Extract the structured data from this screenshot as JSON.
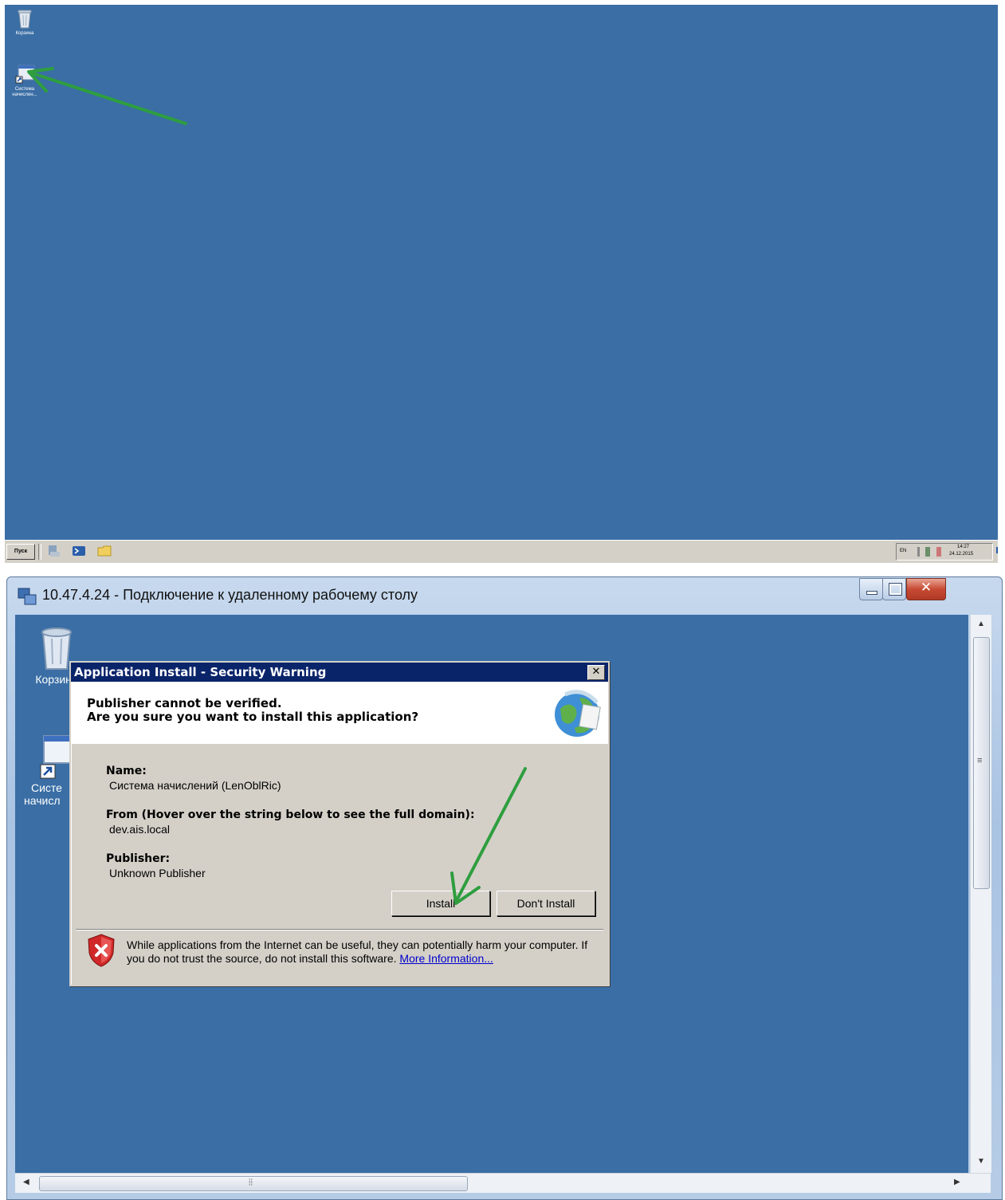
{
  "top_screen": {
    "desktop_icons": [
      {
        "name": "recycle-bin",
        "label": "Корзина"
      },
      {
        "name": "app-shortcut",
        "label": "Система начислен..."
      }
    ],
    "taskbar": {
      "start_label": "Пуск",
      "tray": {
        "language": "EN",
        "time": "14:27",
        "date": "24.12.2015"
      }
    },
    "annotation_color": "#2e9e3f"
  },
  "rdp_window": {
    "title": "10.47.4.24 - Подключение к удаленному рабочему столу",
    "desktop_icons": [
      {
        "label": "Корзина"
      },
      {
        "label_line1": "Систе",
        "label_line2": "начисл"
      }
    ]
  },
  "dialog": {
    "title": "Application Install - Security Warning",
    "header_line1": "Publisher cannot be verified.",
    "header_line2": "Are you sure you want to install this application?",
    "name_label": "Name:",
    "name_value": "Система начислений (LenOblRic)",
    "from_label": "From (Hover over the string below to see the full domain):",
    "from_value": "dev.ais.local",
    "publisher_label": "Publisher:",
    "publisher_value": "Unknown Publisher",
    "install_button": "Install",
    "dont_install_button": "Don't Install",
    "warning_text": "While applications from the Internet can be useful, they can potentially harm your computer. If you do not trust the source, do not install this software.",
    "more_info_link": "More Information..."
  },
  "colors": {
    "desktop_bg": "#3a6ea5",
    "dialog_title_bg": "#0a246a",
    "annotation_arrow": "#2e9e3f"
  }
}
